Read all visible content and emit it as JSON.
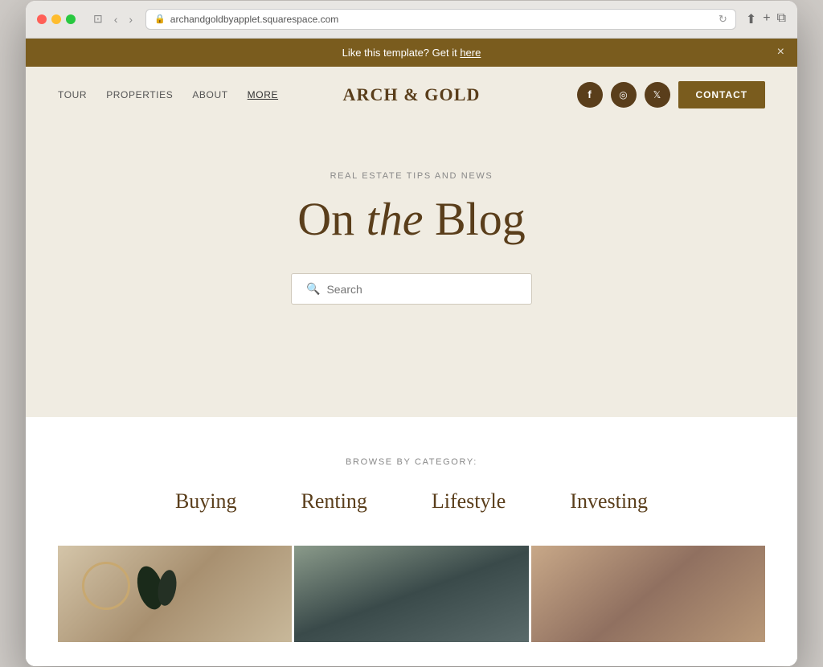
{
  "browser": {
    "url": "archandgoldbyapplet.squarespace.com",
    "reload_label": "↻"
  },
  "banner": {
    "text": "Like this template? Get it ",
    "link_text": "here",
    "close_label": "×"
  },
  "nav": {
    "logo": "ARCH & GOLD",
    "links": [
      {
        "label": "TOUR",
        "active": false
      },
      {
        "label": "PROPERTIES",
        "active": false
      },
      {
        "label": "ABOUT",
        "active": false
      },
      {
        "label": "MORE",
        "active": true
      }
    ],
    "social": [
      {
        "icon": "f",
        "name": "facebook"
      },
      {
        "icon": "📷",
        "name": "instagram"
      },
      {
        "icon": "🐦",
        "name": "twitter"
      }
    ],
    "contact_label": "CONTACT"
  },
  "hero": {
    "subtitle": "REAL ESTATE TIPS AND NEWS",
    "title_part1": "On ",
    "title_italic": "the",
    "title_part2": " Blog",
    "search_placeholder": "Search"
  },
  "content": {
    "browse_label": "BROWSE BY CATEGORY:",
    "categories": [
      {
        "label": "Buying"
      },
      {
        "label": "Renting"
      },
      {
        "label": "Lifestyle"
      },
      {
        "label": "Investing"
      }
    ]
  }
}
